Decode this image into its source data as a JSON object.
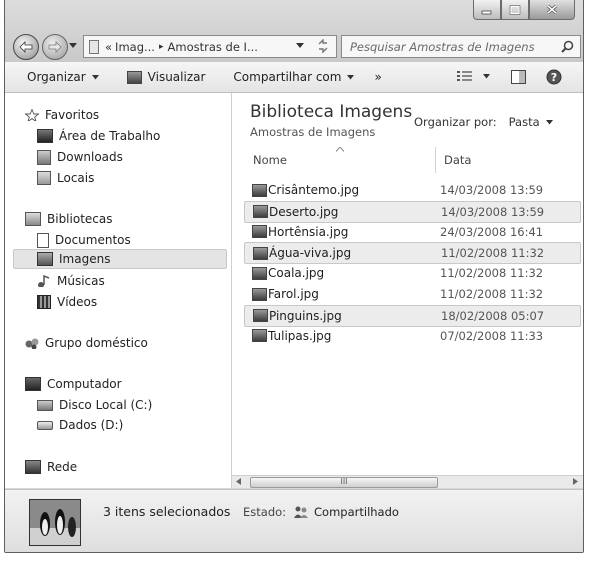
{
  "window": {
    "buttons": {
      "minimize": "minimize-icon",
      "maximize": "maximize-icon",
      "close": "close-icon"
    }
  },
  "navigation": {
    "address_parts": [
      "«",
      "Imag...",
      "▸",
      "Amostras de I..."
    ],
    "search_placeholder": "Pesquisar Amostras de Imagens"
  },
  "toolbar": {
    "organize": "Organizar",
    "view": "Visualizar",
    "share": "Compartilhar com",
    "more": "»"
  },
  "sidebar": {
    "favorites_header": "Favoritos",
    "favorites": [
      "Área de Trabalho",
      "Downloads",
      "Locais"
    ],
    "libraries_header": "Bibliotecas",
    "libraries": [
      "Documentos",
      "Imagens",
      "Músicas",
      "Vídeos"
    ],
    "homegroup": "Grupo doméstico",
    "computer_header": "Computador",
    "drives": [
      "Disco Local (C:)",
      "Dados (D:)"
    ],
    "network": "Rede"
  },
  "library": {
    "title": "Biblioteca Imagens",
    "subtitle": "Amostras de Imagens",
    "arrange_label": "Organizar por:",
    "arrange_value": "Pasta"
  },
  "columns": {
    "name": "Nome",
    "date": "Data"
  },
  "files": [
    {
      "name": "Crisântemo.jpg",
      "date": "14/03/2008 13:59",
      "selected": false
    },
    {
      "name": "Deserto.jpg",
      "date": "14/03/2008 13:59",
      "selected": true
    },
    {
      "name": "Hortênsia.jpg",
      "date": "24/03/2008 16:41",
      "selected": false
    },
    {
      "name": "Água-viva.jpg",
      "date": "11/02/2008 11:32",
      "selected": true
    },
    {
      "name": "Coala.jpg",
      "date": "11/02/2008 11:32",
      "selected": false
    },
    {
      "name": "Farol.jpg",
      "date": "11/02/2008 11:32",
      "selected": false
    },
    {
      "name": "Pinguins.jpg",
      "date": "18/02/2008 05:07",
      "selected": true
    },
    {
      "name": "Tulipas.jpg",
      "date": "07/02/2008 11:33",
      "selected": false
    }
  ],
  "scrollbar": {
    "thumb_grip": "III"
  },
  "status": {
    "selection_text": "3 itens selecionados",
    "state_label": "Estado:",
    "state_value": "Compartilhado"
  }
}
